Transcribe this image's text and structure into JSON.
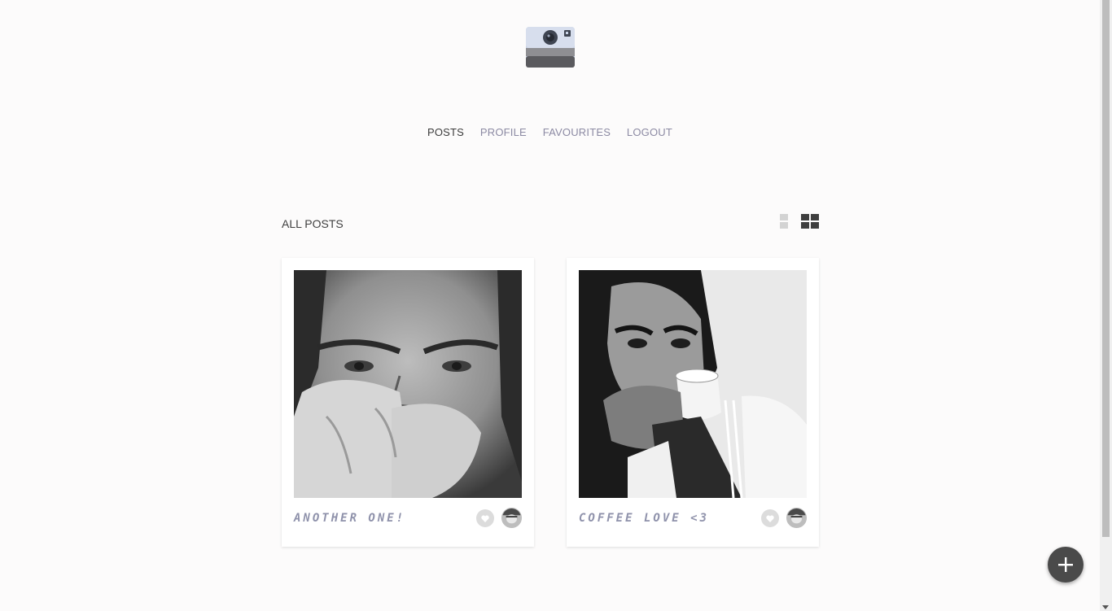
{
  "nav": {
    "items": [
      "POSTS",
      "PROFILE",
      "FAVOURITES",
      "LOGOUT"
    ],
    "active": "POSTS"
  },
  "section": {
    "title": "ALL POSTS"
  },
  "posts": [
    {
      "caption": "ANOTHER ONE!"
    },
    {
      "caption": "COFFEE LOVE <3"
    }
  ],
  "icons": {
    "logo": "camera-icon",
    "view_list": "list-view-icon",
    "view_grid": "grid-view-icon",
    "like": "heart-icon",
    "add": "plus-icon"
  },
  "colors": {
    "background": "#fcfbfb",
    "nav_inactive": "#8c8aa3",
    "nav_active": "#3b3b3b",
    "caption": "#8f92ab",
    "fab": "#4a4a4a"
  }
}
